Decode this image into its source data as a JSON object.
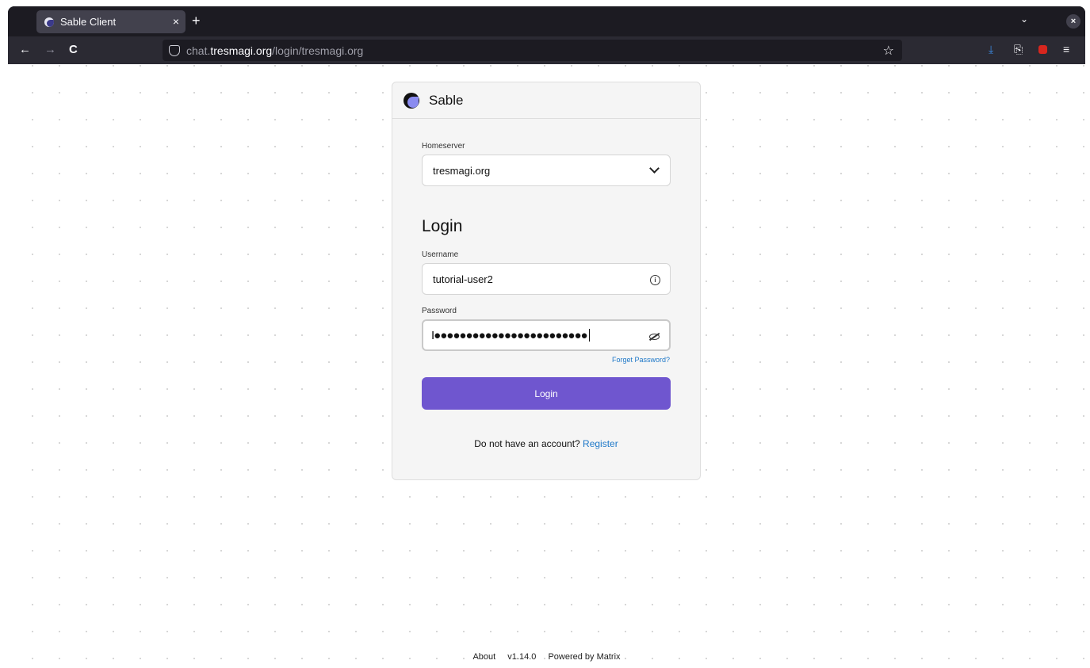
{
  "browser": {
    "tab_title": "Sable Client",
    "tab_close": "×",
    "new_tab": "+",
    "tab_list": "⌄",
    "window_close": "×",
    "back": "←",
    "forward": "→",
    "reload": "C",
    "url_prefix": "chat.",
    "url_host": "tresmagi.org",
    "url_path": "/login/tresmagi.org",
    "bookmark": "☆",
    "downloads_icon": "⤓",
    "share_icon": "⎘",
    "menu_icon": "≡"
  },
  "app": {
    "brand": "Sable",
    "homeserver_label": "Homeserver",
    "homeserver_value": "tresmagi.org",
    "login_heading": "Login",
    "username_label": "Username",
    "username_value": "tutorial-user2",
    "password_label": "Password",
    "password_masked": "I●●●●●●●●●●●●●●●●●●●●●●●●",
    "forget_password": "Forget Password?",
    "login_button": "Login",
    "register_prompt": "Do not have an account?",
    "register_link": "Register"
  },
  "footer": {
    "about": "About",
    "version": "v1.14.0",
    "powered": "Powered by Matrix"
  },
  "colors": {
    "accent": "#6f56cf",
    "link": "#1e78c8"
  }
}
